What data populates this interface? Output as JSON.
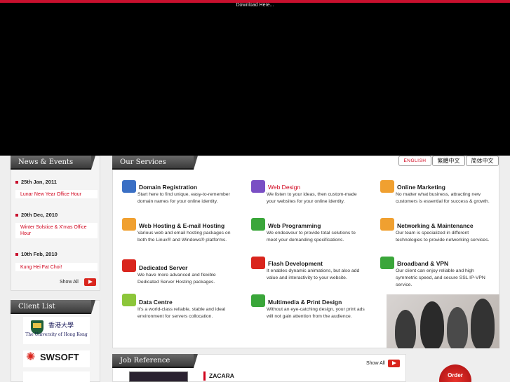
{
  "banner": {
    "download_label": "Download Here..."
  },
  "news": {
    "heading": "News & Events",
    "items": [
      {
        "date": "25th Jan, 2011",
        "title": "Lunar New Year Office Hour"
      },
      {
        "date": "20th Dec, 2010",
        "title": "Winter Solstice & X'mas Office Hour"
      },
      {
        "date": "10th Feb, 2010",
        "title": "Kung Hei Fat Choi!"
      }
    ],
    "show_all": "Show All"
  },
  "clients": {
    "heading": "Client List",
    "hku_chinese": "香港大學",
    "hku_english": "The University of Hong Kong",
    "swsoft": "SWSOFT"
  },
  "services": {
    "heading": "Our Services",
    "languages": [
      "ENGLISH",
      "繁體中文",
      "简体中文"
    ],
    "items": [
      {
        "title": "Domain Registration",
        "desc": "Start here to find unique, easy-to-remember domain names for your online identity.",
        "icon": "www-icon",
        "color": "#3a6fc4"
      },
      {
        "title": "Web Design",
        "desc": "We listen to your ideas, then custom-made your websites for your online identity.",
        "icon": "pen-icon",
        "color": "#7a4fc4"
      },
      {
        "title": "Online Marketing",
        "desc": "No matter what business, attracting new customers is essential for success & growth.",
        "icon": "monitor-icon",
        "color": "#f0a030"
      },
      {
        "title": "Web Hosting & E-mail Hosting",
        "desc": "Various web and email hosting packages on both the Linux® and Windows® platforms.",
        "icon": "globe-icon",
        "color": "#f0a030"
      },
      {
        "title": "Web Programming",
        "desc": "We endeavour to provide total solutions to meet your demanding specifications.",
        "icon": "grid-icon",
        "color": "#3aa63a"
      },
      {
        "title": "Networking & Maintenance",
        "desc": "Our team is specialized in different technologies to provide networking services.",
        "icon": "tools-icon",
        "color": "#f0a030"
      },
      {
        "title": "Dedicated Server",
        "desc": "We have more advanced and flexible Dedicated Server Hosting packages.",
        "icon": "server-icon",
        "color": "#d9251d"
      },
      {
        "title": "Flash Development",
        "desc": "It enables dynamic animations, but also add value and interactivity to your website.",
        "icon": "flash-icon",
        "color": "#d9251d"
      },
      {
        "title": "Broadband & VPN",
        "desc": "Our client can enjoy reliable and high symmetric speed, and secure SSL IP-VPN service.",
        "icon": "broadband-icon",
        "color": "#3aa63a"
      },
      {
        "title": "Data Centre",
        "desc": "It's a world-class reliable, stable and ideal environment for servers collocation.",
        "icon": "datacentre-icon",
        "color": "#8cc63a"
      },
      {
        "title": "Multimedia & Print Design",
        "desc": "Without an eye-catching design, your print ads will not gain attention from the audience.",
        "icon": "media-icon",
        "color": "#3aa63a"
      }
    ]
  },
  "jobs": {
    "heading": "Job Reference",
    "show_all": "Show All",
    "first_client": "ZACARA"
  },
  "order": {
    "label": "Order"
  }
}
